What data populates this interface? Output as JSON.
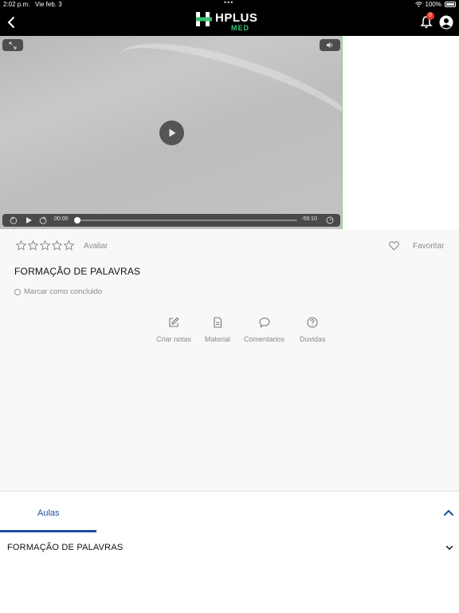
{
  "status_bar": {
    "time": "2:02 p.m.",
    "date": "Vie feb. 3",
    "battery": "100%"
  },
  "app_bar": {
    "logo_main": "HPLUS",
    "logo_sub": "MED",
    "notification_count": "0",
    "brand_green": "#38c172"
  },
  "player": {
    "current_time": "00:00",
    "remaining_time": "-59:10",
    "progress": 0
  },
  "lesson": {
    "rating_stars": 5,
    "rate_label": "Avaliar",
    "favorite_label": "Favoritar",
    "title": "FORMAÇÃO DE PALAVRAS",
    "mark_complete_label": "Marcar como concluido"
  },
  "actions": [
    {
      "label": "Criar notas",
      "icon": "edit-icon"
    },
    {
      "label": "Material",
      "icon": "document-icon"
    },
    {
      "label": "Comentarios",
      "icon": "comment-icon"
    },
    {
      "label": "Duvidas",
      "icon": "question-icon"
    }
  ],
  "tabs": {
    "active": "Aulas",
    "accent": "#1e4ea0"
  },
  "lessons_list": [
    {
      "title": "FORMAÇÃO DE PALAVRAS"
    }
  ]
}
